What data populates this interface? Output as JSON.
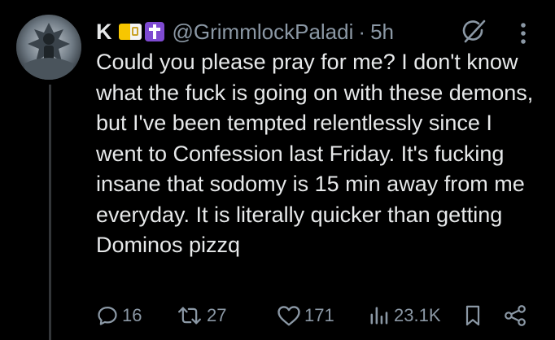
{
  "post": {
    "display_name": "K",
    "handle": "@GrimmlockPaladi",
    "separator": "·",
    "time": "5h",
    "badges": [
      "vatican-flag-icon",
      "latin-cross-icon"
    ],
    "text": "Could you please pray for me? I don't know what the fuck is going on with these demons, but I've been tempted relentlessly since I went to Confession last Friday. It's fucking insane that sodomy is  15 min away from me everyday. It is literally quicker than getting Dominos pizzq"
  },
  "actions": {
    "replies": "16",
    "reposts": "27",
    "likes": "171",
    "views": "23.1K"
  },
  "colors": {
    "background": "#000000",
    "text": "#e7e9ea",
    "muted": "#8b98a5",
    "thread_line": "#333639"
  }
}
